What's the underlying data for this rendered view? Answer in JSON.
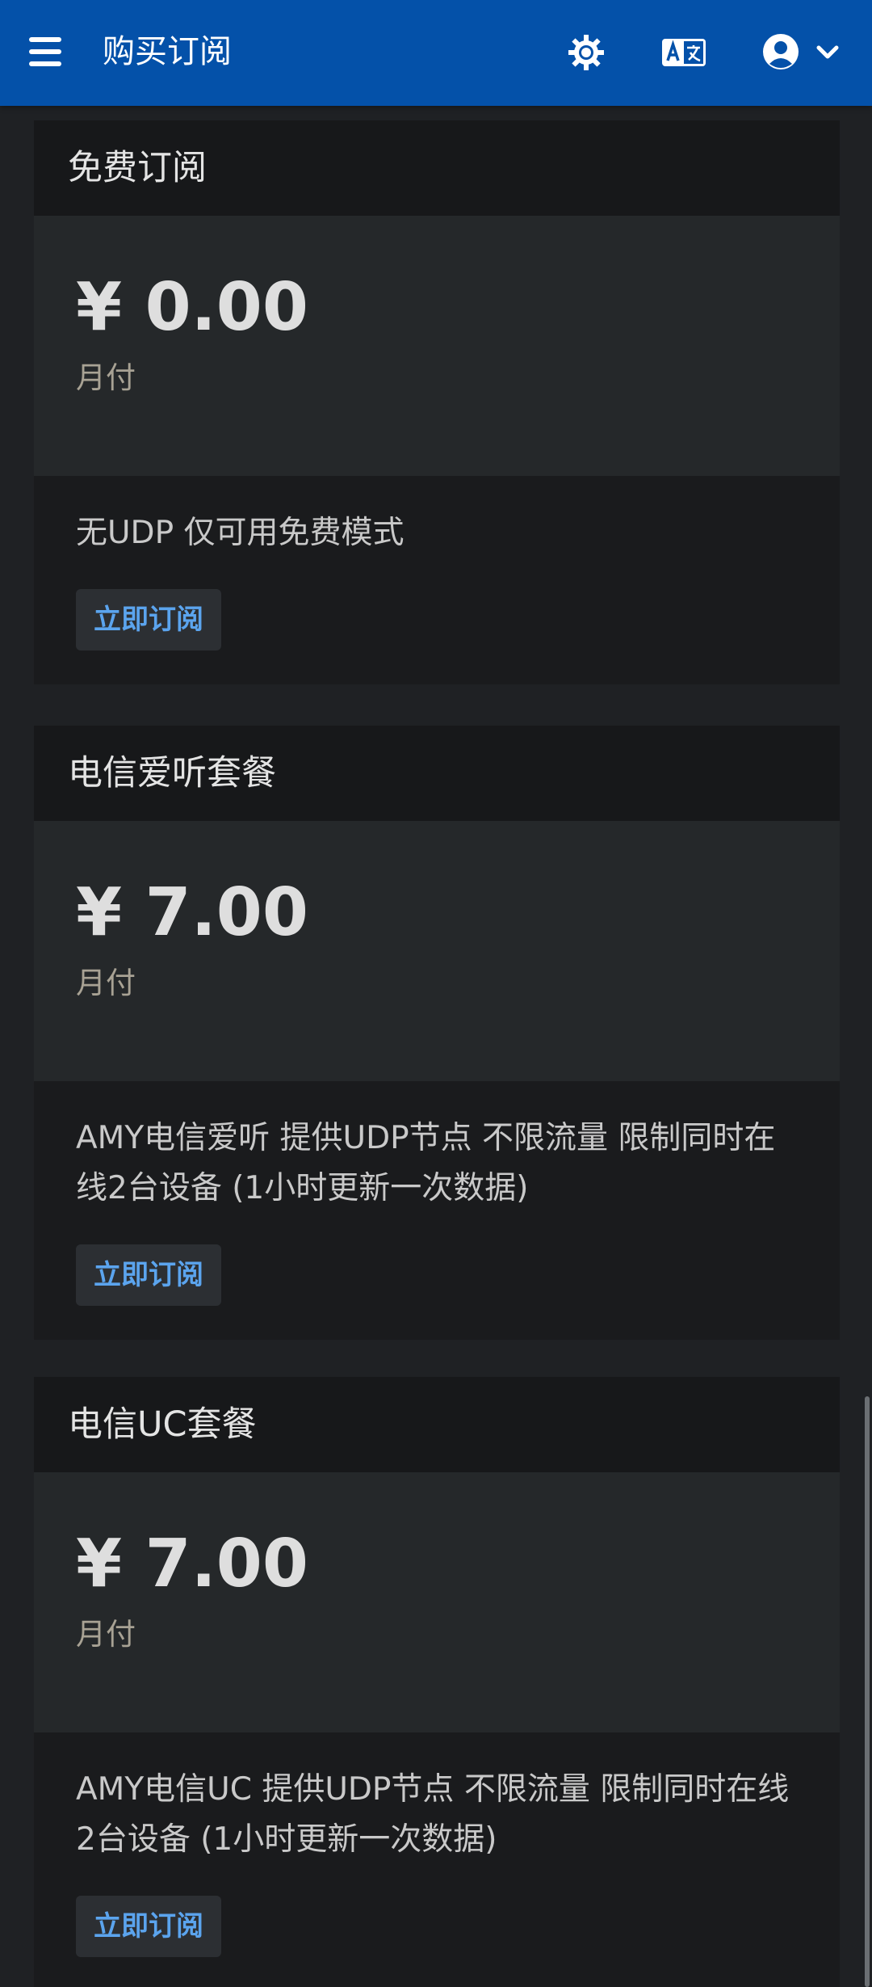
{
  "header": {
    "title": "购买订阅",
    "icons": [
      "menu-icon",
      "theme-toggle-icon",
      "translate-icon",
      "user-icon",
      "chevron-down-icon"
    ]
  },
  "colors": {
    "topbar": "#0451a9",
    "background": "#1f2124",
    "button_text": "#5ba4ee"
  },
  "plans": [
    {
      "name": "免费订阅",
      "price": "¥ 0.00",
      "period": "月付",
      "description": "无UDP 仅可用免费模式",
      "button": "立即订阅"
    },
    {
      "name": "电信爱听套餐",
      "price": "¥ 7.00",
      "period": "月付",
      "description": "AMY电信爱听 提供UDP节点 不限流量 限制同时在线2台设备 (1小时更新一次数据)",
      "button": "立即订阅"
    },
    {
      "name": "电信UC套餐",
      "price": "¥ 7.00",
      "period": "月付",
      "description": "AMY电信UC 提供UDP节点 不限流量 限制同时在线2台设备 (1小时更新一次数据)",
      "button": "立即订阅"
    }
  ]
}
